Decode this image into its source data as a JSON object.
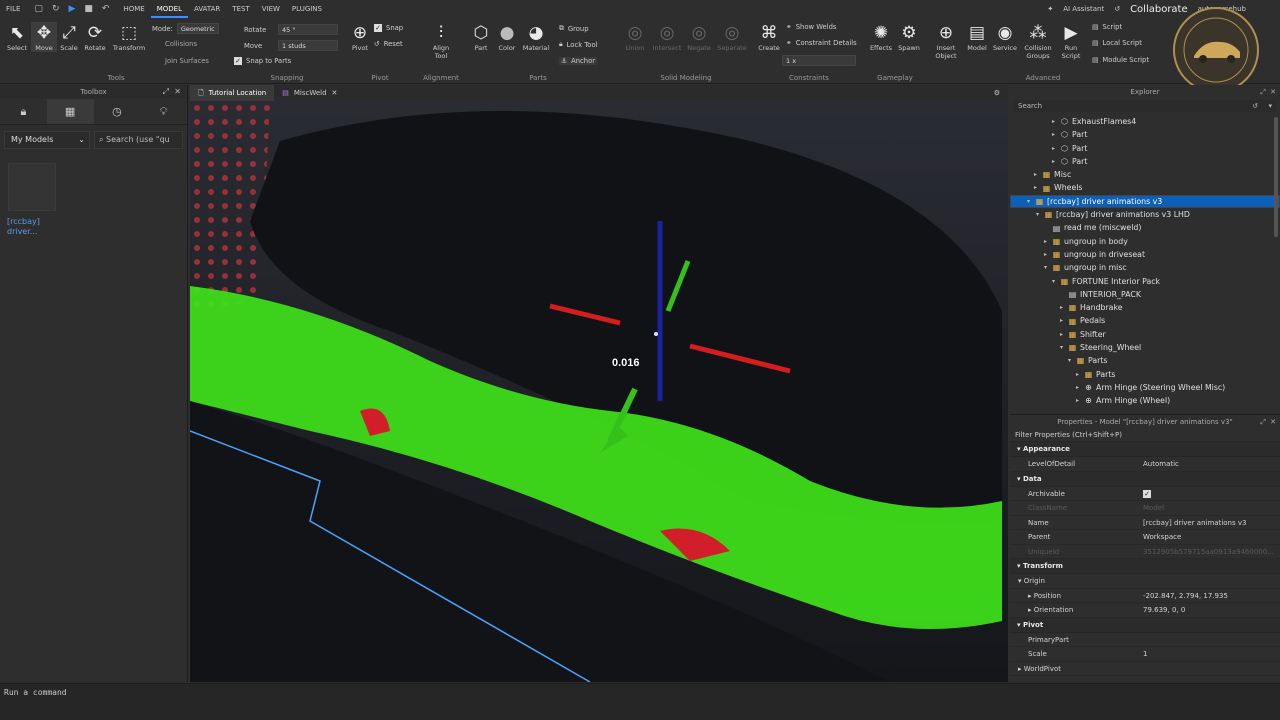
{
  "menu": {
    "file": "FILE",
    "home": "HOME",
    "model": "MODEL",
    "avatar": "AVATAR",
    "test": "TEST",
    "view": "VIEW",
    "plugins": "PLUGINS"
  },
  "topright": {
    "assistant": "AI Assistant",
    "collaborate": "Collaborate",
    "user": "autoversehub"
  },
  "tools": {
    "select": "Select",
    "move": "Move",
    "scale": "Scale",
    "rotate": "Rotate",
    "transform": "Transform",
    "label": "Tools"
  },
  "snapping": {
    "mode_label": "Mode:",
    "mode_value": "Geometric",
    "collisions": "Collisions",
    "join_surfaces": "Join Surfaces",
    "rotate_label": "Rotate",
    "rotate_value": "45 °",
    "move_label": "Move",
    "move_value": "1 studs",
    "snap_to_parts": "Snap to Parts",
    "label": "Snapping"
  },
  "pivot": {
    "pivot": "Pivot",
    "snap": "Snap",
    "reset": "Reset",
    "label": "Pivot"
  },
  "alignment": {
    "align_tool": "Align Tool",
    "label": "Alignment"
  },
  "parts": {
    "part": "Part",
    "color": "Color",
    "material": "Material",
    "group": "Group",
    "lock_tool": "Lock Tool",
    "anchor": "Anchor",
    "label": "Parts"
  },
  "solid": {
    "union": "Union",
    "intersect": "Intersect",
    "negate": "Negate",
    "separate": "Separate",
    "label": "Solid Modeling"
  },
  "constraints": {
    "create": "Create",
    "show_welds": "Show Welds",
    "constraint_details": "Constraint Details",
    "scale_value": "1 x",
    "label": "Constraints"
  },
  "gameplay": {
    "effects": "Effects",
    "spawn": "Spawn",
    "label": "Gameplay"
  },
  "advanced": {
    "insert_object": "Insert Object",
    "model": "Model",
    "service": "Service",
    "collision_groups": "Collision Groups",
    "run_script": "Run Script",
    "script": "Script",
    "local_script": "Local Script",
    "module_script": "Module Script",
    "label": "Advanced"
  },
  "toolbox": {
    "title": "Toolbox",
    "category": "My Models",
    "search_placeholder": "Search (use \"qu",
    "item_name": "[rccbay] driver..."
  },
  "tabs": [
    {
      "label": "Tutorial Location"
    },
    {
      "label": "MiscWeld"
    }
  ],
  "viewport": {
    "measurement": "0.016"
  },
  "explorer": {
    "title": "Explorer",
    "search_placeholder": "Search",
    "nodes": [
      {
        "label": "ExhaustFlames4",
        "icon": "part"
      },
      {
        "label": "Part",
        "icon": "part"
      },
      {
        "label": "Part",
        "icon": "part"
      },
      {
        "label": "Part",
        "icon": "part"
      },
      {
        "label": "Misc",
        "icon": "model"
      },
      {
        "label": "Wheels",
        "icon": "model"
      },
      {
        "label": "[rccbay] driver animations v3",
        "icon": "model"
      },
      {
        "label": "[rccbay] driver animations v3 LHD",
        "icon": "model"
      },
      {
        "label": "read me (miscweld)",
        "icon": "script"
      },
      {
        "label": "ungroup in body",
        "icon": "model"
      },
      {
        "label": "ungroup in driveseat",
        "icon": "model"
      },
      {
        "label": "ungroup in misc",
        "icon": "model"
      },
      {
        "label": "FORTUNE Interior Pack",
        "icon": "model"
      },
      {
        "label": "INTERIOR_PACK",
        "icon": "script"
      },
      {
        "label": "Handbrake",
        "icon": "model"
      },
      {
        "label": "Pedals",
        "icon": "model"
      },
      {
        "label": "Shifter",
        "icon": "model"
      },
      {
        "label": "Steering_Wheel",
        "icon": "model"
      },
      {
        "label": "Parts",
        "icon": "model"
      },
      {
        "label": "Parts",
        "icon": "model"
      },
      {
        "label": "Arm Hinge (Steering Wheel Misc)",
        "icon": "hinge"
      },
      {
        "label": "Arm Hinge (Wheel)",
        "icon": "hinge"
      }
    ]
  },
  "properties": {
    "title": "Properties - Model \"[rccbay] driver animations v3\"",
    "filter": "Filter Properties (Ctrl+Shift+P)",
    "appearance": "Appearance",
    "level_of_detail_k": "LevelOfDetail",
    "level_of_detail_v": "Automatic",
    "data": "Data",
    "archivable_k": "Archivable",
    "classname_k": "ClassName",
    "classname_v": "Model",
    "name_k": "Name",
    "name_v": "[rccbay] driver animations v3",
    "parent_k": "Parent",
    "parent_v": "Workspace",
    "uniqueid_k": "UniqueId",
    "uniqueid_v": "3512905b579715aa0913a9460000...",
    "transform": "Transform",
    "origin_k": "Origin",
    "position_k": "Position",
    "position_v": "-202.847, 2.794, 17.935",
    "orientation_k": "Orientation",
    "orientation_v": "79.639, 0, 0",
    "pivot": "Pivot",
    "primarypart_k": "PrimaryPart",
    "scale_k": "Scale",
    "scale_v": "1",
    "worldpivot_k": "WorldPivot"
  },
  "command": {
    "placeholder": "Run a command"
  },
  "logo": {
    "text": "AUTOVERSE HUB DRIVEN"
  },
  "colors": {
    "accent": "#3f8cff",
    "selection": "#0e5fb8",
    "green_part": "#3fe21a",
    "model_icon": "#e7b94f"
  }
}
